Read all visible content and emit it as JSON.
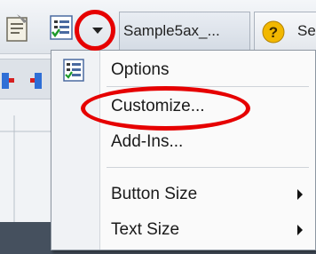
{
  "toolbar": {
    "document_tab": "Sample5ax_...",
    "help_tab_label": "Se",
    "icons": {
      "properties": "properties-icon",
      "options": "options-list-icon",
      "dropdown": "chevron-down-icon",
      "help": "help-question-icon"
    }
  },
  "menu": {
    "items": [
      {
        "label": "Options",
        "icon": "options-list-icon"
      },
      {
        "label": "Customize..."
      },
      {
        "label": "Add-Ins..."
      },
      {
        "label": "Button Size",
        "submenu": true
      },
      {
        "label": "Text Size",
        "submenu": true
      }
    ]
  },
  "colors": {
    "annotation": "#e60000",
    "menu_background": "#fafafa",
    "help_icon": "#f2b800",
    "checkmark": "#1e9a2a"
  }
}
